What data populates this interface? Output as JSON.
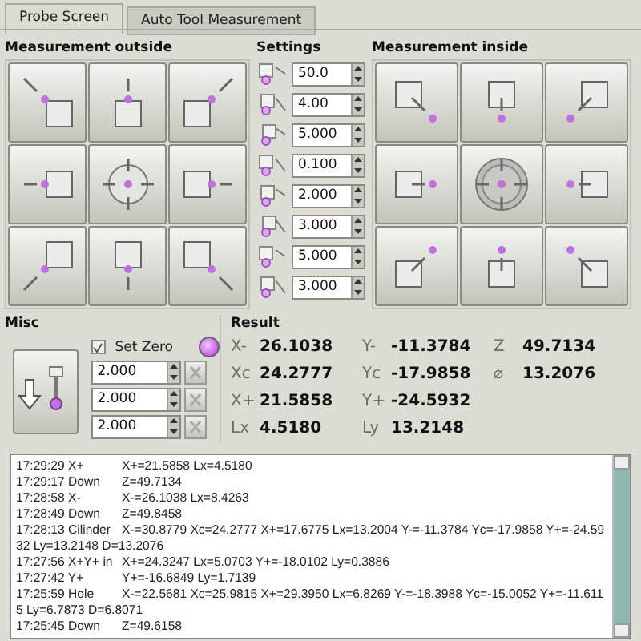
{
  "tabs": [
    {
      "label": "Probe Screen",
      "selected": true
    },
    {
      "label": "Auto Tool Measurement",
      "selected": false
    }
  ],
  "outside": {
    "title": "Measurement outside"
  },
  "settings": {
    "title": "Settings",
    "values": [
      "50.0",
      "4.00",
      "5.000",
      "0.100",
      "2.000",
      "3.000",
      "5.000",
      "3.000"
    ]
  },
  "inside": {
    "title": "Measurement inside"
  },
  "misc": {
    "title": "Misc",
    "set_zero": {
      "label": "Set Zero",
      "checked": true
    },
    "led": {
      "on": true
    },
    "offsets": [
      "2.000",
      "2.000",
      "2.000"
    ]
  },
  "result": {
    "title": "Result",
    "columns": [
      [
        {
          "label": "X-",
          "value": "26.1038"
        },
        {
          "label": "Xc",
          "value": "24.2777"
        },
        {
          "label": "X+",
          "value": "21.5858"
        },
        {
          "label": "Lx",
          "value": "4.5180"
        }
      ],
      [
        {
          "label": "Y-",
          "value": "-11.3784"
        },
        {
          "label": "Yc",
          "value": "-17.9858"
        },
        {
          "label": "Y+",
          "value": "-24.5932"
        },
        {
          "label": "Ly",
          "value": "13.2148"
        }
      ],
      [
        {
          "label": "Z",
          "value": "49.7134"
        },
        {
          "label": "⌀",
          "value": "13.2076"
        }
      ]
    ]
  },
  "log": [
    {
      "head": "17:29:29 X+",
      "text": "X+=21.5858 Lx=4.5180"
    },
    {
      "head": "17:29:17 Down",
      "text": "Z=49.7134"
    },
    {
      "head": "17:28:58 X-",
      "text": "X-=26.1038 Lx=8.4263"
    },
    {
      "head": "17:28:49 Down",
      "text": "Z=49.8458"
    },
    {
      "head": "17:28:13 Cilinder",
      "text": "X-=30.8779 Xc=24.2777 X+=17.6775 Lx=13.2004 Y-=-11.3784 Yc=-17.9858 Y+=-24.5932 Ly=13.2148 D=13.2076"
    },
    {
      "head": "17:27:56 X+Y+ in",
      "text": "X+=24.3247 Lx=5.0703 Y+=-18.0102 Ly=0.3886"
    },
    {
      "head": "17:27:42 Y+",
      "text": "Y+=-16.6849 Ly=1.7139"
    },
    {
      "head": "17:25:59 Hole",
      "text": "X-=22.5681 Xc=25.9815 X+=29.3950 Lx=6.8269 Y-=-18.3988 Yc=-15.0052 Y+=-11.6115 Ly=6.7873 D=6.8071"
    },
    {
      "head": "17:25:45 Down",
      "text": "Z=49.6158"
    }
  ]
}
